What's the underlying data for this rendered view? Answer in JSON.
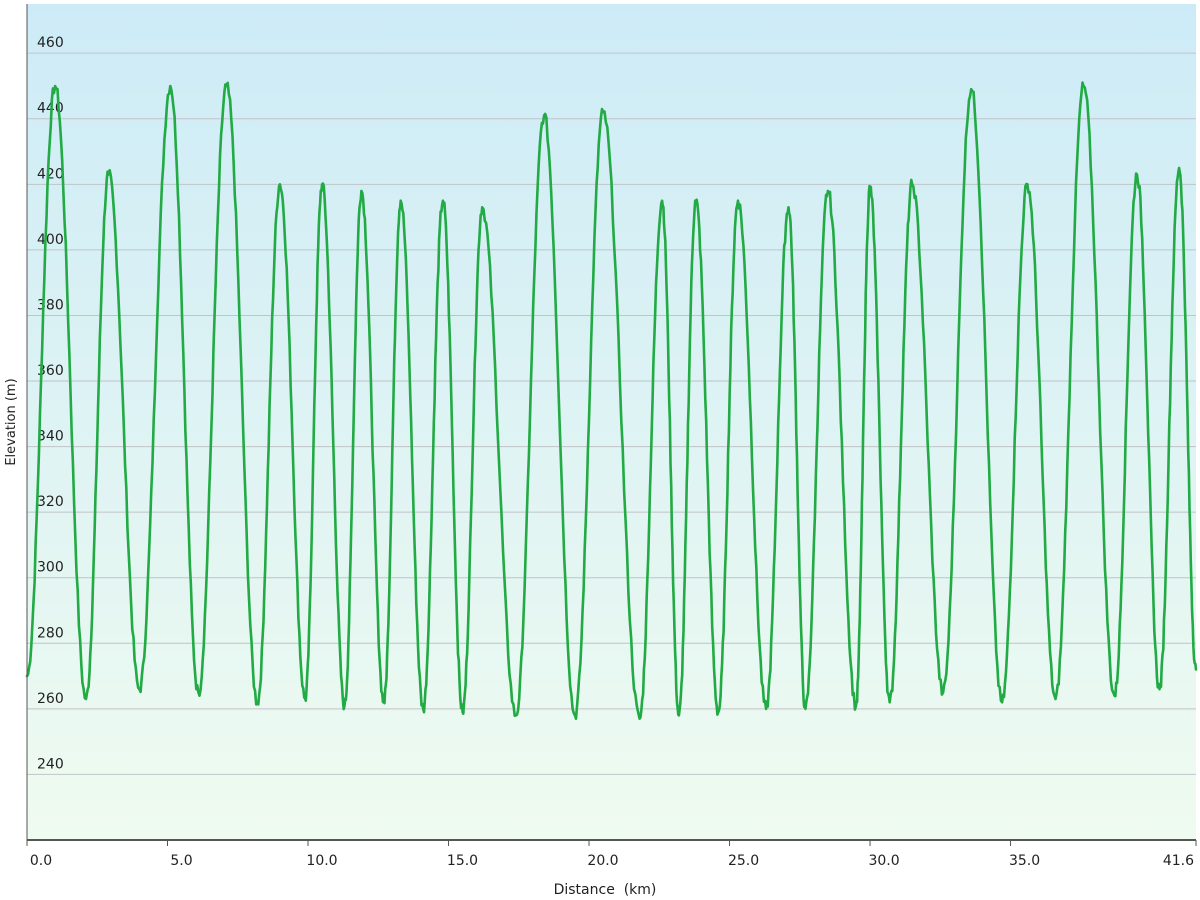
{
  "chart_data": {
    "type": "area",
    "title": "",
    "xlabel": "Distance  (km)",
    "ylabel": "Elevation (m)",
    "xlim": [
      0.0,
      41.6
    ],
    "ylim": [
      220,
      475
    ],
    "x_ticks": [
      0.0,
      5.0,
      10.0,
      15.0,
      20.0,
      25.0,
      30.0,
      35.0,
      41.6
    ],
    "x_tick_labels": [
      "0.0",
      "5.0",
      "10.0",
      "15.0",
      "20.0",
      "25.0",
      "30.0",
      "35.0",
      "41.6"
    ],
    "y_ticks": [
      240,
      260,
      280,
      300,
      320,
      340,
      360,
      380,
      400,
      420,
      440,
      460
    ],
    "y_tick_labels": [
      "240",
      "260",
      "280",
      "300",
      "320",
      "340",
      "360",
      "380",
      "400",
      "420",
      "440",
      "460"
    ],
    "grid": true,
    "legend": "none",
    "colors": {
      "line": "#22aa44",
      "fill_top": "#cdebf7",
      "fill_bottom": "#effbf0",
      "grid": "#c0c4c8",
      "axis": "#555555",
      "text": "#222222"
    },
    "series": [
      {
        "x": [
          0.0,
          1.0,
          2.1,
          2.9,
          4.0,
          5.1,
          6.1,
          7.1,
          8.2,
          9.0,
          9.9,
          10.5,
          11.3,
          11.9,
          12.7,
          13.3,
          14.1,
          14.8,
          15.5,
          16.2,
          17.4,
          18.4,
          19.5,
          20.5,
          21.8,
          22.6,
          23.2,
          23.8,
          24.6,
          25.3,
          26.3,
          27.1,
          27.7,
          28.5,
          29.5,
          30.0,
          30.7,
          31.5,
          32.6,
          33.6,
          34.7,
          35.6,
          36.6,
          37.6,
          38.7,
          39.5,
          40.3,
          41.0,
          41.6
        ],
        "y": [
          270,
          450,
          263,
          423,
          266,
          450,
          265,
          450,
          262,
          420,
          263,
          420,
          261,
          418,
          262,
          415,
          260,
          415,
          259,
          413,
          258,
          441,
          258,
          442,
          257,
          415,
          258,
          415,
          259,
          415,
          260,
          413,
          260,
          418,
          261,
          419,
          262,
          420,
          265,
          449,
          262,
          420,
          263,
          450,
          264,
          423,
          266,
          425,
          272
        ]
      }
    ]
  }
}
